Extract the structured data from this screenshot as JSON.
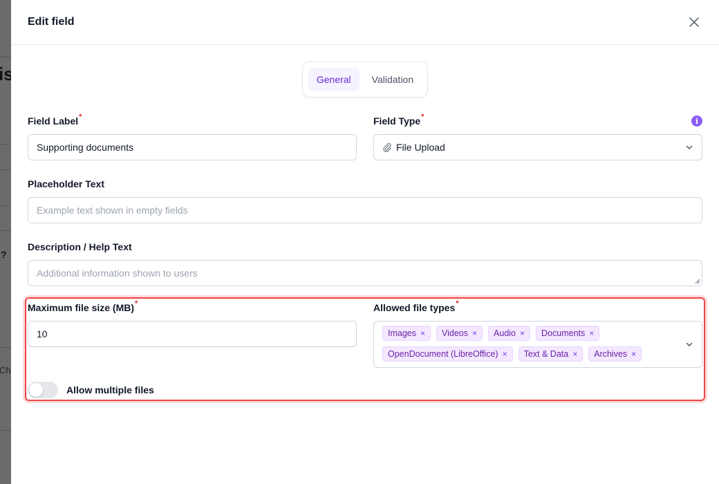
{
  "background": {
    "fragments": [
      "is",
      "?",
      "Ch"
    ]
  },
  "dialog": {
    "title": "Edit field",
    "close_icon": "close-icon"
  },
  "tabs": [
    {
      "label": "General",
      "active": true
    },
    {
      "label": "Validation",
      "active": false
    }
  ],
  "fields": {
    "field_label": {
      "label": "Field Label",
      "required_mark": "*",
      "value": "Supporting documents"
    },
    "field_type": {
      "label": "Field Type",
      "required_mark": "*",
      "value": "File Upload",
      "icon": "paperclip-icon",
      "info_icon": "info-icon",
      "info_glyph": "i"
    },
    "placeholder_text": {
      "label": "Placeholder Text",
      "placeholder": "Example text shown in empty fields"
    },
    "description": {
      "label": "Description / Help Text",
      "placeholder": "Additional information shown to users"
    },
    "max_file_size": {
      "label": "Maximum file size (MB)",
      "required_mark": "*",
      "value": "10"
    },
    "allowed_types": {
      "label": "Allowed file types",
      "required_mark": "*",
      "tags": [
        "Images",
        "Videos",
        "Audio",
        "Documents",
        "OpenDocument (LibreOffice)",
        "Text & Data",
        "Archives"
      ],
      "remove_glyph": "×"
    },
    "allow_multiple": {
      "label": "Allow multiple files",
      "enabled": false
    }
  },
  "colors": {
    "accent": "#6d28d9",
    "tag_bg": "#f3e8ff",
    "highlight": "#ef4444",
    "required": "#dc2626"
  }
}
